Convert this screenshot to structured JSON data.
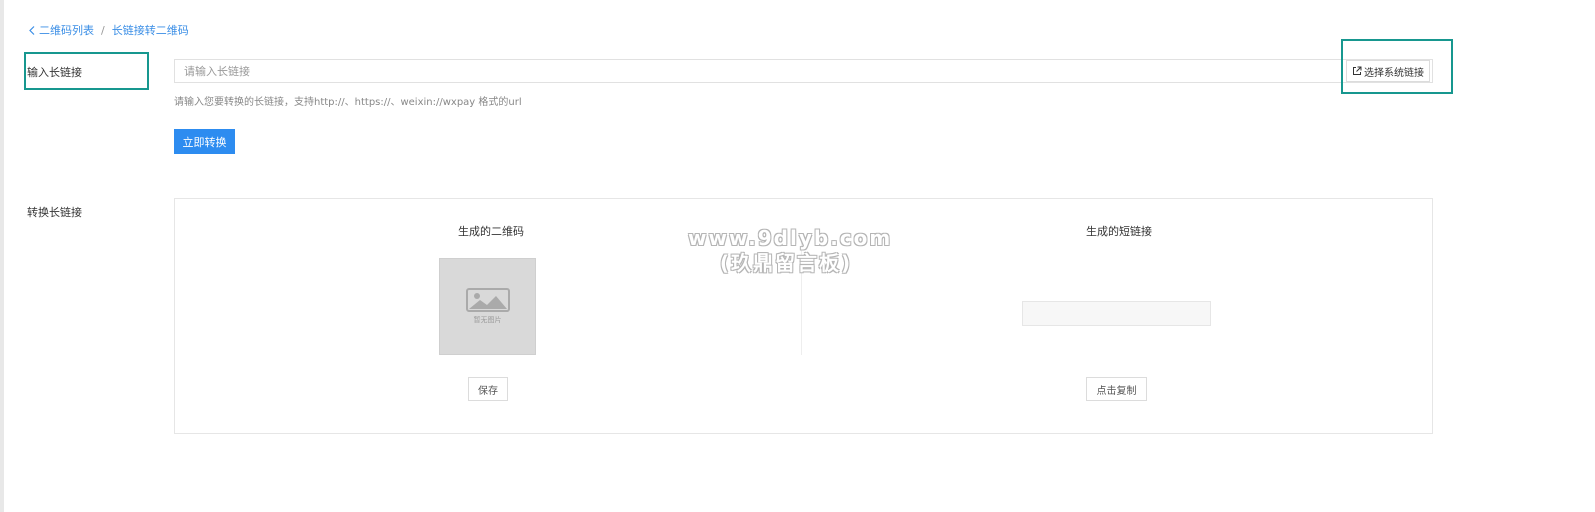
{
  "breadcrumb": {
    "parent": "二维码列表",
    "separator": "/",
    "current": "长链接转二维码"
  },
  "form": {
    "long_url_label": "输入长链接",
    "long_url_placeholder": "请输入长链接",
    "long_url_value": "",
    "select_system_link_label": "选择系统链接",
    "hint": "请输入您要转换的长链接，支持http://、https://、weixin://wxpay 格式的url",
    "convert_button": "立即转换"
  },
  "result": {
    "label": "转换长链接",
    "qr_title": "生成的二维码",
    "qr_placeholder_text": "暂无图片",
    "save_button": "保存",
    "short_link_title": "生成的短链接",
    "short_link_value": "",
    "copy_button": "点击复制"
  },
  "watermark": {
    "line1": "www.9dlyb.com",
    "line2": "(玖鼎留言板)"
  },
  "colors": {
    "link": "#3a8ee6",
    "primary": "#2d8cf0",
    "highlight_border": "#17978f"
  },
  "icons": {
    "back": "chevron-left-icon",
    "external_link": "external-link-icon",
    "image_placeholder": "image-icon"
  }
}
